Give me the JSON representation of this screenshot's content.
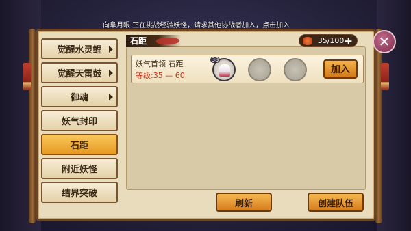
{
  "notice": "向阜月眼 正在挑战经验妖怪，请求其他协战者加入，点击加入",
  "sidebar": {
    "items": [
      {
        "label": "觉醒水灵鲤",
        "arrow": true
      },
      {
        "label": "觉醒天雷鼓",
        "arrow": true
      },
      {
        "label": "御魂",
        "arrow": true
      },
      {
        "label": "妖气封印",
        "arrow": false
      },
      {
        "label": "石距",
        "arrow": false,
        "active": true
      },
      {
        "label": "附近妖怪",
        "arrow": false
      },
      {
        "label": "结界突破",
        "arrow": false
      }
    ]
  },
  "header": {
    "tab_label": "石距"
  },
  "stamina": {
    "value": "35/100",
    "plus": "+",
    "icon": "drum-icon"
  },
  "close": {
    "icon": "close-icon",
    "glyph": "✕"
  },
  "card": {
    "title": "妖气首领 石距",
    "level": "等级:35 — 60",
    "slot1_level": "38",
    "join_label": "加入"
  },
  "buttons": {
    "refresh": "刷新",
    "create": "创建队伍"
  },
  "colors": {
    "accent": "#e79a22",
    "panel": "#e9dcbc",
    "border": "#6b4523",
    "level_text": "#c0381e"
  }
}
